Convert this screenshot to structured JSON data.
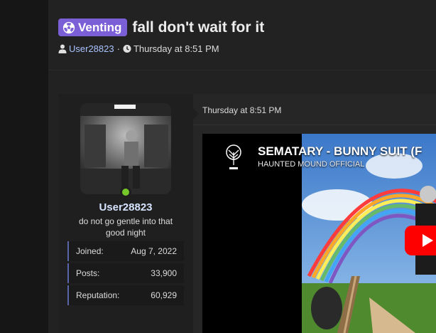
{
  "thread": {
    "prefix": "Venting",
    "title": "fall don't wait for it",
    "author": "User28823",
    "separator": "·",
    "date": "Thursday at 8:51 PM"
  },
  "user": {
    "name": "User28823",
    "title": "do not go gentle into that good night",
    "online": true,
    "stats": {
      "joined_label": "Joined:",
      "joined_value": "Aug 7, 2022",
      "posts_label": "Posts:",
      "posts_value": "33,900",
      "reputation_label": "Reputation:",
      "reputation_value": "60,929"
    }
  },
  "post": {
    "date": "Thursday at 8:51 PM",
    "video": {
      "title": "SEMATARY - BUNNY SUIT (F",
      "channel": "HAUNTED MOUND OFFICIAL"
    }
  },
  "colors": {
    "prefix_bg": "#7b5fd6",
    "online": "#76c72a",
    "link": "#a9c3ff",
    "play": "#ff0000"
  },
  "icons": [
    "radiation-icon",
    "user-icon",
    "clock-icon",
    "tree-logo-icon",
    "play-icon"
  ]
}
